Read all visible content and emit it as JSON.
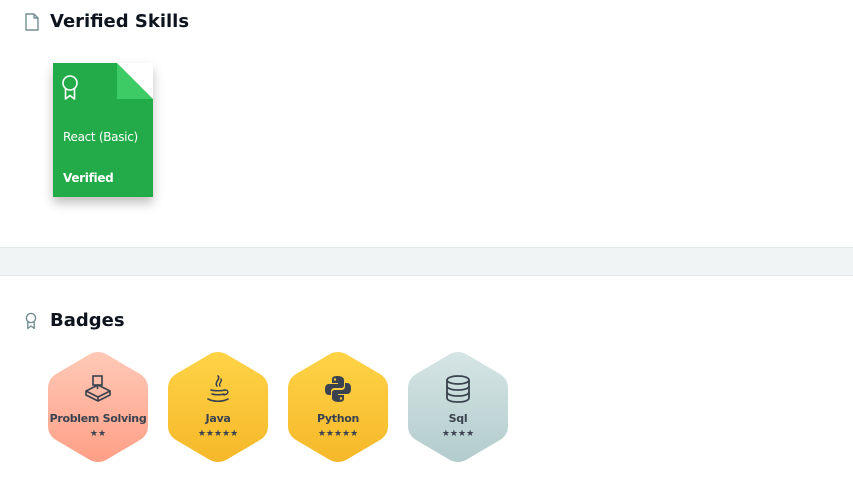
{
  "verified_skills": {
    "title": "Verified Skills",
    "header_icon": "document-icon",
    "cards": [
      {
        "name": "React (Basic)",
        "status": "Verified",
        "icon": "award-icon",
        "color": "#23ab4a",
        "fold_color": "#3ccb64"
      }
    ]
  },
  "badges": {
    "title": "Badges",
    "header_icon": "award-icon",
    "items": [
      {
        "name": "Problem Solving",
        "stars": "★★",
        "star_count": 2,
        "icon": "problem-solving-icon",
        "colors": [
          "#ffc9b7",
          "#ff9f86"
        ]
      },
      {
        "name": "Java",
        "stars": "★★★★★",
        "star_count": 5,
        "icon": "java-icon",
        "colors": [
          "#ffd347",
          "#f5b82a"
        ]
      },
      {
        "name": "Python",
        "stars": "★★★★★",
        "star_count": 5,
        "icon": "python-icon",
        "colors": [
          "#ffd347",
          "#f5b82a"
        ]
      },
      {
        "name": "Sql",
        "stars": "★★★★",
        "star_count": 4,
        "icon": "database-icon",
        "colors": [
          "#d6e5e5",
          "#b3cccc"
        ]
      }
    ]
  }
}
